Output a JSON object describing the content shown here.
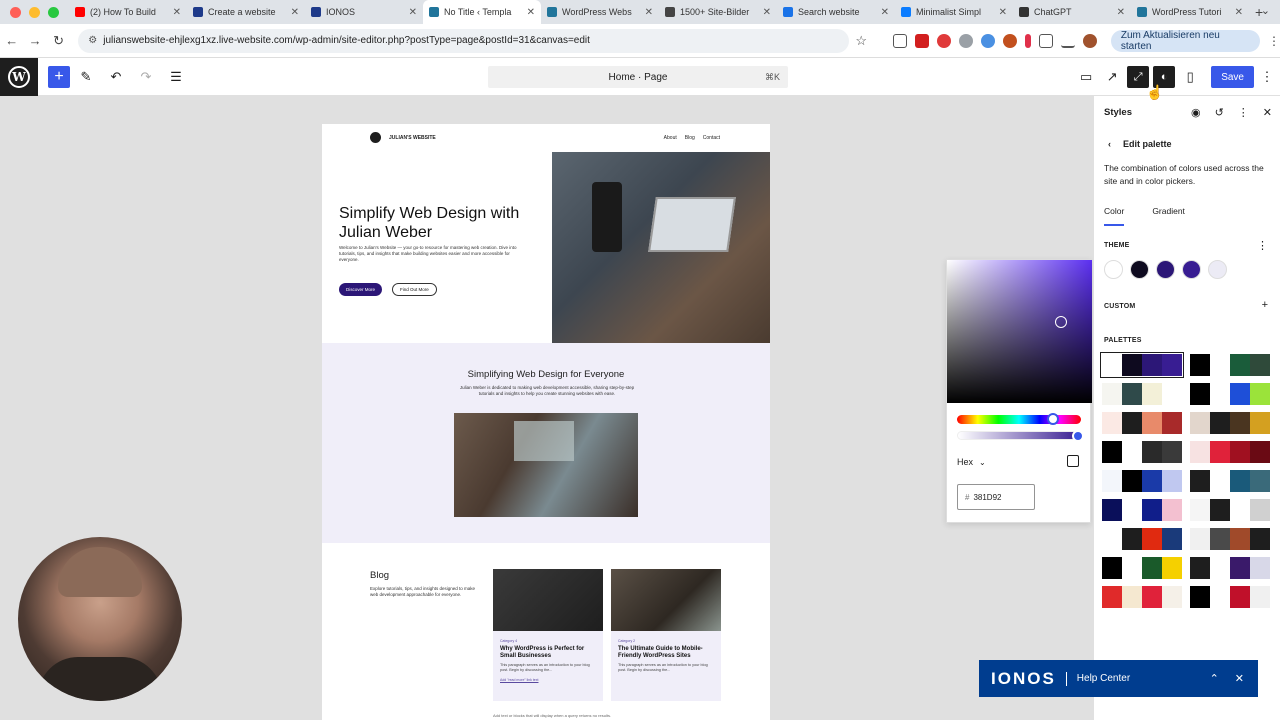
{
  "browser": {
    "tabs": [
      {
        "label": "(2) How To Build",
        "color": "#ff0000"
      },
      {
        "label": "Create a website",
        "color": "#1e3a8a"
      },
      {
        "label": "IONOS",
        "color": "#1e3a8a"
      },
      {
        "label": "No Title ‹ Templa",
        "color": "#21759b",
        "active": true
      },
      {
        "label": "WordPress Webs",
        "color": "#21759b"
      },
      {
        "label": "1500+ Site-Bilder",
        "color": "#444444"
      },
      {
        "label": "Search website",
        "color": "#1a73e8"
      },
      {
        "label": "Minimalist Simpl",
        "color": "#0a7cff"
      },
      {
        "label": "ChatGPT",
        "color": "#333333"
      },
      {
        "label": "WordPress Tutori",
        "color": "#21759b"
      }
    ],
    "url": "julianswebsite-ehjlexg1xz.live-website.com/wp-admin/site-editor.php?postType=page&postId=31&canvas=edit",
    "update_label": "Zum Aktualisieren neu starten"
  },
  "editor": {
    "doc_title": "Home · Page",
    "shortcut": "⌘K",
    "save_label": "Save"
  },
  "site": {
    "title": "JULIAN'S WEBSITE",
    "nav": [
      "About",
      "Blog",
      "Contact"
    ],
    "hero_title": "Simplify Web Design with Julian Weber",
    "hero_desc": "Welcome to Julian's Website — your go-to resource for mastering web creation. Dive into tutorials, tips, and insights that make building websites easier and more accessible for everyone.",
    "btn_primary": "Discover More",
    "btn_secondary": "Find Out More",
    "about_title": "Simplifying Web Design for Everyone",
    "about_desc": "Julian Weber is dedicated to making web development accessible, sharing step-by-step tutorials and insights to help you create stunning websites with ease.",
    "blog_title": "Blog",
    "blog_desc": "Explore tutorials, tips, and insights designed to make web development approachable for everyone.",
    "posts": [
      {
        "category": "Category 4",
        "title": "Why WordPress is Perfect for Small Businesses",
        "desc": "This paragraph serves as an introduction to your blog post. Begin by discussing the...",
        "more": "Add \"read more\" link text"
      },
      {
        "category": "Category 2",
        "title": "The Ultimate Guide to Mobile-Friendly WordPress Sites",
        "desc": "This paragraph serves as an introduction to your blog post. Begin by discussing the..."
      }
    ],
    "query_note": "Add text or blocks that will display when a query returns no results."
  },
  "picker": {
    "format": "Hex",
    "hex_value": "381D92",
    "hash": "#"
  },
  "styles": {
    "header": "Styles",
    "back_title": "Edit palette",
    "description": "The combination of colors used across the site and in color pickers.",
    "tab_color": "Color",
    "tab_gradient": "Gradient",
    "theme_label": "THEME",
    "custom_label": "CUSTOM",
    "palettes_label": "PALETTES",
    "theme_colors": [
      "#ffffff",
      "#0e0a1f",
      "#2c1777",
      "#381d92",
      "#ecebf5"
    ],
    "palettes": [
      [
        "#ffffff",
        "#0e0a1f",
        "#2c1777",
        "#381d92"
      ],
      [
        "#000000",
        "#ffffff",
        "#1a5c3a",
        "#2f4a3a"
      ],
      [
        "#f5f5f0",
        "#2f4a4a",
        "#f3f0d8",
        "#ffffff"
      ],
      [
        "#000000",
        "#ffffff",
        "#1e4fd8",
        "#9be33a"
      ],
      [
        "#fbe9e4",
        "#1e1e1e",
        "#e88a6a",
        "#a82a2a"
      ],
      [
        "#e2d6cc",
        "#1e1e1e",
        "#4a3520",
        "#d4a020"
      ],
      [
        "#000000",
        "#ffffff",
        "#2a2a2a",
        "#3a3a3a"
      ],
      [
        "#f7e2e2",
        "#e0223a",
        "#a01020",
        "#6a0a14"
      ],
      [
        "#f3f6fb",
        "#000000",
        "#1a3aa8",
        "#c0c8f0"
      ],
      [
        "#1e1e1e",
        "#ffffff",
        "#1a5a7a",
        "#3a6a7a"
      ],
      [
        "#0a0f5a",
        "#ffffff",
        "#101e8a",
        "#f3c0d0"
      ],
      [
        "#f5f5f5",
        "#1e1e1e",
        "#ffffff",
        "#d0d0d0"
      ],
      [
        "#ffffff",
        "#1e1e1e",
        "#e02a10",
        "#1a3a7a"
      ],
      [
        "#f0f0f0",
        "#4a4a4a",
        "#a04a2a",
        "#1e1e1e"
      ],
      [
        "#000000",
        "#ffffff",
        "#1a5a2a",
        "#f5d000"
      ],
      [
        "#1e1e1e",
        "#ffffff",
        "#3a1a6a",
        "#d8d8e8"
      ],
      [
        "#e02a2a",
        "#f5e8d0",
        "#e0223a",
        "#f5f0e8"
      ],
      [
        "#000000",
        "#ffffff",
        "#c0102a",
        "#f0f0f0"
      ]
    ]
  },
  "help": {
    "brand": "IONOS",
    "label": "Help Center"
  }
}
